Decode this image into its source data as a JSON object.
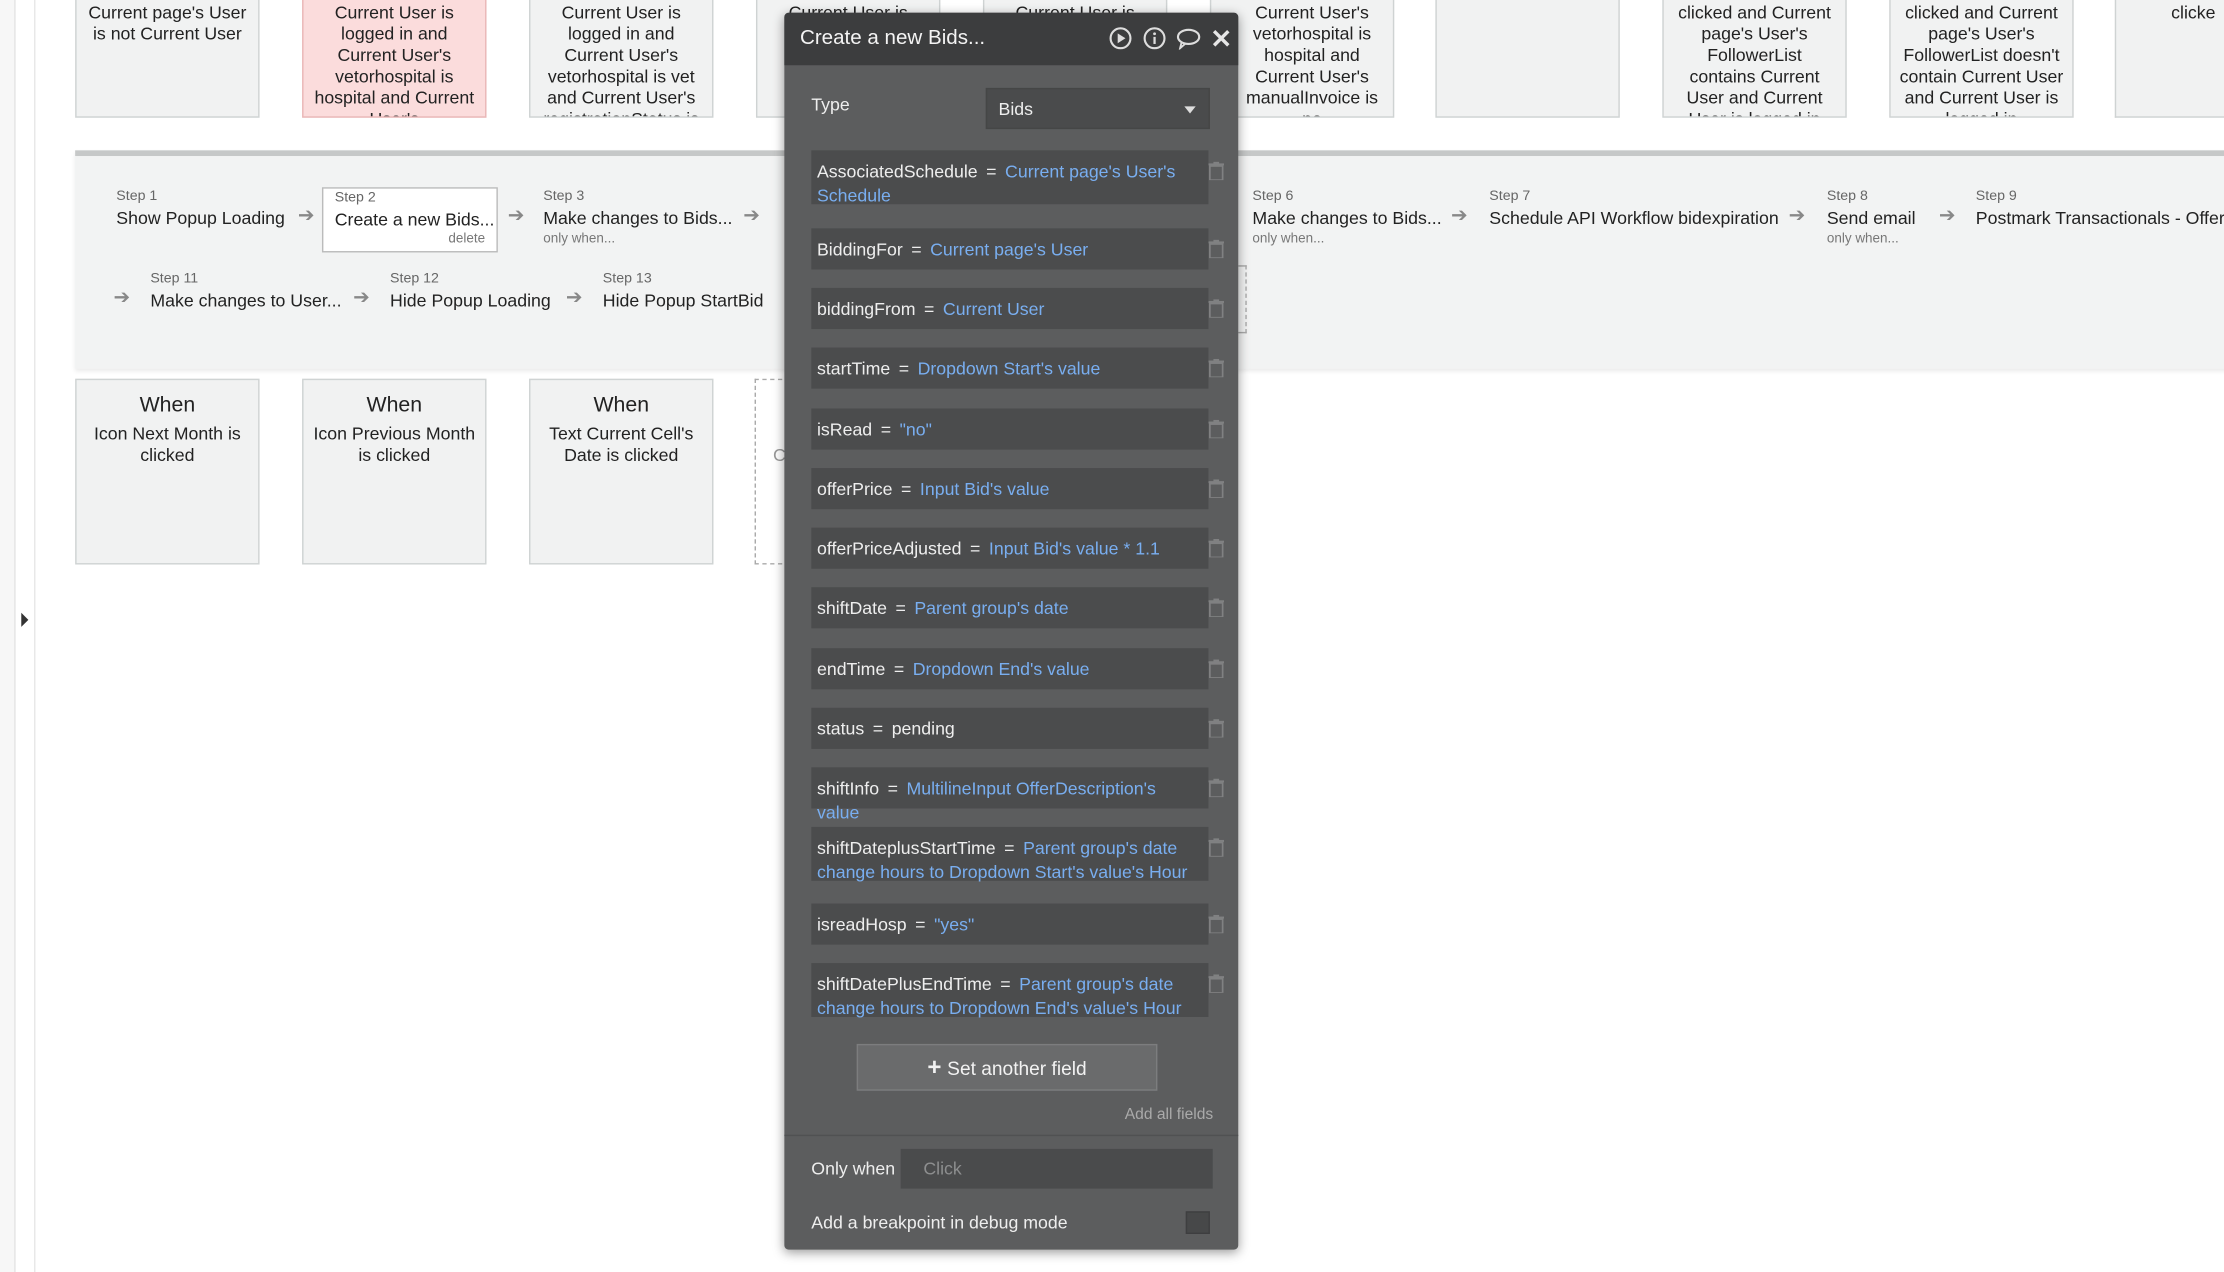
{
  "events_top": [
    {
      "text": "Current page's User is not Current User"
    },
    {
      "text": "Current User is logged in and Current User's vetorhospital is hospital and Current User's registrationStatus is"
    },
    {
      "text": "Current User is logged in and Current User's vetorhospital is vet and Current User's registrationStatus is not verified"
    },
    {
      "text": "Current User is logged in and"
    },
    {
      "text": "Current User is logged"
    },
    {
      "text": "Current User's vetorhospital is hospital and Current User's manualInvoice is no"
    },
    {
      "text": ""
    },
    {
      "text": "clicked and Current page's User's FollowerList contains Current User and Current User is logged in"
    },
    {
      "text": "clicked and Current page's User's FollowerList doesn't contain Current User and Current User is logged in"
    },
    {
      "text": "clicke"
    }
  ],
  "workflow": {
    "steps": [
      {
        "num": "Step 1",
        "label": "Show Popup Loading",
        "sub": ""
      },
      {
        "num": "Step 2",
        "label": "Create a new Bids...",
        "sub": "",
        "delete": "delete"
      },
      {
        "num": "Step 3",
        "label": "Make changes to Bids...",
        "sub": "only when..."
      },
      {
        "num": "Step 6",
        "label": "Make changes to Bids...",
        "sub": "only when..."
      },
      {
        "num": "Step 7",
        "label": "Schedule API Workflow bidexpiration",
        "sub": ""
      },
      {
        "num": "Step 8",
        "label": "Send email",
        "sub": "only when..."
      },
      {
        "num": "Step 9",
        "label": "Postmark Transactionals - Offer R",
        "sub": ""
      },
      {
        "num": "Step 11",
        "label": "Make changes to User...",
        "sub": ""
      },
      {
        "num": "Step 12",
        "label": "Hide Popup Loading",
        "sub": ""
      },
      {
        "num": "Step 13",
        "label": "Hide Popup StartBid",
        "sub": ""
      }
    ]
  },
  "events_when": [
    {
      "when": "When",
      "text": "Icon Next Month is clicked"
    },
    {
      "when": "When",
      "text": "Icon Previous Month is clicked"
    },
    {
      "when": "When",
      "text": "Text Current Cell's Date is clicked"
    },
    {
      "when": "",
      "text": "C"
    }
  ],
  "modal": {
    "title": "Create a new Bids...",
    "icons": [
      "play-icon",
      "info-icon",
      "comment-icon",
      "close-icon"
    ],
    "type_label": "Type",
    "type_value": "Bids",
    "fields": [
      {
        "name": "AssociatedSchedule",
        "eq": "=",
        "value": "Current page's User's Schedule",
        "plain": false
      },
      {
        "name": "BiddingFor",
        "eq": "=",
        "value": "Current page's User",
        "plain": false
      },
      {
        "name": "biddingFrom",
        "eq": "=",
        "value": "Current User",
        "plain": false
      },
      {
        "name": "startTime",
        "eq": "=",
        "value": "Dropdown Start's value",
        "plain": false
      },
      {
        "name": "isRead",
        "eq": "=",
        "value": "\"no\"",
        "plain": false
      },
      {
        "name": "offerPrice",
        "eq": "=",
        "value": "Input Bid's value",
        "plain": false
      },
      {
        "name": "offerPriceAdjusted",
        "eq": "=",
        "value": "Input Bid's value * 1.1",
        "plain": false
      },
      {
        "name": "shiftDate",
        "eq": "=",
        "value": "Parent group's date",
        "plain": false
      },
      {
        "name": "endTime",
        "eq": "=",
        "value": "Dropdown End's value",
        "plain": false
      },
      {
        "name": "status",
        "eq": "=",
        "value": "pending",
        "plain": true
      },
      {
        "name": "shiftInfo",
        "eq": "=",
        "value": "MultilineInput OfferDescription's value",
        "plain": false
      },
      {
        "name": "shiftDateplusStartTime",
        "eq": "=",
        "value": "Parent group's date change hours to Dropdown Start's value's Hour",
        "plain": false
      },
      {
        "name": "isreadHosp",
        "eq": "=",
        "value": "\"yes\"",
        "plain": false
      },
      {
        "name": "shiftDatePlusEndTime",
        "eq": "=",
        "value": "Parent group's date change hours to Dropdown End's value's Hour",
        "plain": false
      }
    ],
    "set_field_label": "Set another field",
    "add_all_label": "Add all fields",
    "only_when_label": "Only when",
    "only_when_placeholder": "Click",
    "breakpoint_label": "Add a breakpoint in debug mode"
  }
}
